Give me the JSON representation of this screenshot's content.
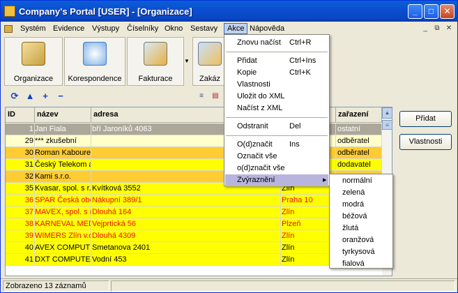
{
  "window": {
    "title": "Company's Portal [USER] - [Organizace]",
    "buttons": [
      "_",
      "□",
      "✕"
    ]
  },
  "menubar": {
    "items": [
      "Systém",
      "Evidence",
      "Výstupy",
      "Číselníky",
      "Okno",
      "Sestavy",
      "Akce",
      "Nápověda"
    ],
    "mdi_controls": [
      "_",
      "⧉",
      "✕"
    ]
  },
  "toolbar": {
    "buttons": [
      "Organizace",
      "Korespondence",
      "Fakturace",
      "Zakáz"
    ]
  },
  "grid": {
    "columns": [
      "ID",
      "název",
      "adresa",
      "",
      "zařazení"
    ],
    "rows": [
      {
        "id": "1",
        "nazev": "Jan Fiala",
        "adresa": "bří Jaroníků 4063",
        "mesto": "",
        "zar": "ostatní",
        "style": "selected"
      },
      {
        "id": "29",
        "nazev": "*** zkušební",
        "adresa": "",
        "mesto": "",
        "zar": "odběratel",
        "style": "lightyellow"
      },
      {
        "id": "30",
        "nazev": "Roman Kabourek",
        "adresa": "",
        "mesto": "",
        "zar": "odběratel",
        "style": "orange"
      },
      {
        "id": "31",
        "nazev": "Český Telekom a.s.",
        "adresa": "",
        "mesto": "",
        "zar": "dodavatel",
        "style": "yellow"
      },
      {
        "id": "32",
        "nazev": "Kami s.r.o.",
        "adresa": "",
        "mesto": "",
        "zar": "",
        "style": "orange"
      },
      {
        "id": "35",
        "nazev": "Kvasar, spol. s r.o.",
        "adresa": "Kvítková 3552",
        "mesto": "Zlín",
        "zar": "",
        "style": "yellow"
      },
      {
        "id": "36",
        "nazev": "SPAR Česká obchodní",
        "adresa": "Nákupní 389/1",
        "mesto": "Praha 10",
        "zar": "",
        "style": "yellow-red"
      },
      {
        "id": "37",
        "nazev": "MAVEX, spol. s r.o.",
        "adresa": "Dlouhá 164",
        "mesto": "Zlín",
        "zar": "",
        "style": "yellow-red"
      },
      {
        "id": "38",
        "nazev": "KARNEVAL MEDIA",
        "adresa": "Vejprtická 56",
        "mesto": "Plzeň",
        "zar": "",
        "style": "yellow-red"
      },
      {
        "id": "39",
        "nazev": "WIMERS Zlín v.o.s.",
        "adresa": "Dlouhá 4309",
        "mesto": "Zlín",
        "zar": "",
        "style": "yellow-red"
      },
      {
        "id": "40",
        "nazev": "AVEX COMPUTER",
        "adresa": "Smetanova 2401",
        "mesto": "Zlín",
        "zar": "",
        "style": "yellow"
      },
      {
        "id": "41",
        "nazev": "DXT COMPUTER",
        "adresa": "Vodní 453",
        "mesto": "Zlín",
        "zar": "",
        "style": "yellow"
      }
    ]
  },
  "side_buttons": {
    "add": "Přidat",
    "props": "Vlastnosti"
  },
  "statusbar": {
    "text": "Zobrazeno 13 záznamů"
  },
  "akce_menu": {
    "items": [
      {
        "label": "Znovu načíst",
        "shortcut": "Ctrl+R"
      },
      {
        "label": "Přidat",
        "shortcut": "Ctrl+Ins"
      },
      {
        "label": "Kopie",
        "shortcut": "Ctrl+K"
      },
      {
        "label": "Vlastnosti",
        "shortcut": ""
      },
      {
        "label": "Uložit do XML",
        "shortcut": ""
      },
      {
        "label": "Načíst z XML",
        "shortcut": ""
      },
      {
        "label": "Odstranit",
        "shortcut": "Del"
      },
      {
        "label": "O(d)značit",
        "shortcut": "Ins"
      },
      {
        "label": "Označit vše",
        "shortcut": ""
      },
      {
        "label": "o(d)značit vše",
        "shortcut": ""
      },
      {
        "label": "Zvýraznění",
        "shortcut": ""
      }
    ],
    "submenu_arrow": "▸"
  },
  "highlight_submenu": [
    "normální",
    "zelená",
    "modrá",
    "béžová",
    "žlutá",
    "oranžová",
    "tyrkysová",
    "fialová"
  ],
  "colors": {
    "row_yellow": "#ffff00",
    "row_orange": "#ffcc33",
    "row_lightyellow": "#ffffcc",
    "row_selected": "#aca899",
    "text_red": "#e81010"
  }
}
